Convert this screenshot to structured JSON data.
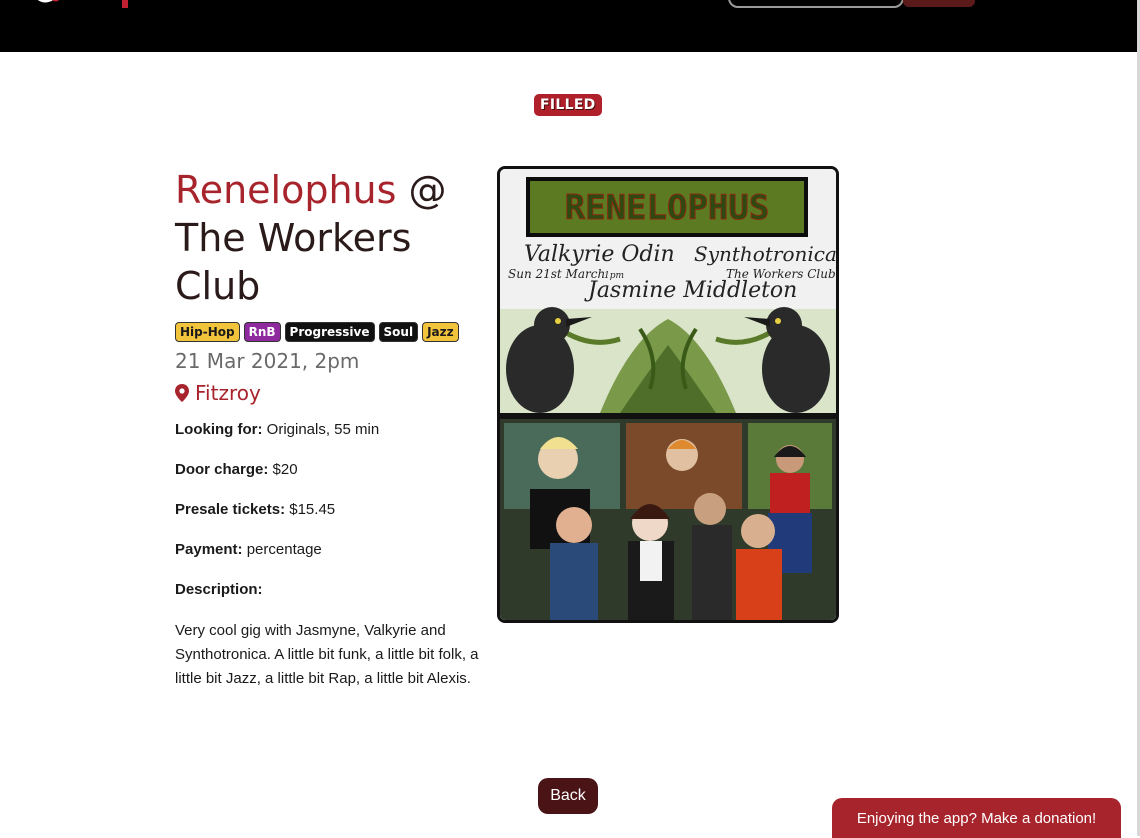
{
  "status_badge": "FILLED",
  "gig": {
    "band": "Renelophus",
    "at": "@",
    "venue": "The Workers Club",
    "date": "21 Mar 2021, 2pm",
    "location": "Fitzroy"
  },
  "tags": [
    {
      "label": "Hip-Hop",
      "bg": "#f2c43c",
      "fg": "#1a1a1a"
    },
    {
      "label": "RnB",
      "bg": "#8e2a9e",
      "fg": "#ffffff"
    },
    {
      "label": "Progressive",
      "bg": "#111111",
      "fg": "#ffffff"
    },
    {
      "label": "Soul",
      "bg": "#111111",
      "fg": "#ffffff"
    },
    {
      "label": "Jazz",
      "bg": "#f2c43c",
      "fg": "#1a1a1a"
    }
  ],
  "details": {
    "looking_for_label": "Looking for:",
    "looking_for_value": "Originals, 55 min",
    "door_label": "Door charge:",
    "door_value": "$20",
    "presale_label": "Presale tickets:",
    "presale_value": "$15.45",
    "payment_label": "Payment:",
    "payment_value": "percentage",
    "description_label": "Description:",
    "description_text": "Very cool gig with Jasmyne, Valkyrie and Synthotronica. A little bit funk, a little bit folk, a little bit Jazz, a little bit Rap, a little bit Alexis."
  },
  "poster": {
    "logo_text": "RENELOPHUS",
    "artist_1": "Valkyrie Odin",
    "artist_2": "Synthotronica",
    "artist_3": "Jasmine Middleton",
    "date_line": "Sun 21st March",
    "time_line": "1pm",
    "venue_line": "The Workers Club"
  },
  "back_label": "Back",
  "donate_label": "Enjoying the app? Make a donation!",
  "colors": {
    "accent": "#a8242c",
    "dark_button": "#4a1416",
    "nav_bg": "#000000"
  }
}
